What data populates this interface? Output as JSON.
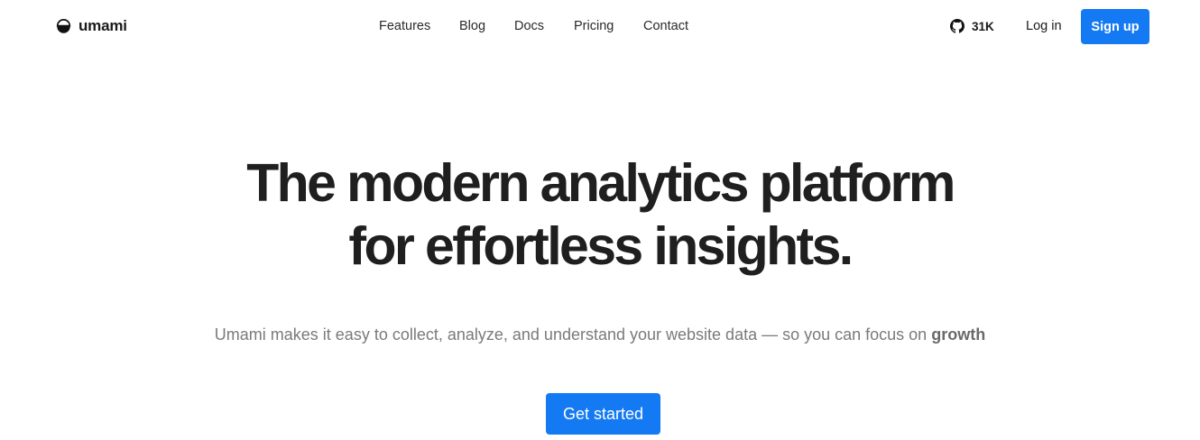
{
  "brand": {
    "name": "umami",
    "logo_icon": "umami-logo-icon"
  },
  "nav": {
    "items": [
      {
        "label": "Features"
      },
      {
        "label": "Blog"
      },
      {
        "label": "Docs"
      },
      {
        "label": "Pricing"
      },
      {
        "label": "Contact"
      }
    ]
  },
  "header_actions": {
    "github_icon": "github-icon",
    "github_stars": "31K",
    "login_label": "Log in",
    "signup_label": "Sign up"
  },
  "hero": {
    "title_line1": "The modern analytics platform",
    "title_line2": "for effortless insights.",
    "subtitle_text": "Umami makes it easy to collect, analyze, and understand your website data — so you can focus on ",
    "subtitle_emphasis": "growth",
    "cta_label": "Get started"
  },
  "colors": {
    "accent": "#147af3",
    "text": "#1f1f1f",
    "muted": "#7a7a7a"
  }
}
